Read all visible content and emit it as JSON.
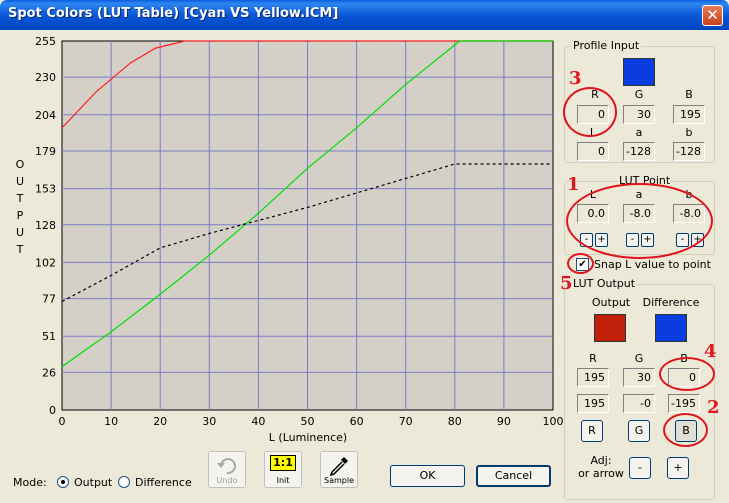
{
  "window": {
    "title": "Spot Colors (LUT Table) [Cyan VS Yellow.ICM]",
    "close_glyph": "✕"
  },
  "chart_data": {
    "type": "line",
    "ylabel": "OUTPUT",
    "xlabel": "L (Luminence)",
    "xlim": [
      0,
      100
    ],
    "ylim": [
      0,
      255
    ],
    "x_ticks": [
      "0",
      "10",
      "20",
      "30",
      "40",
      "50",
      "60",
      "70",
      "80",
      "90",
      "100"
    ],
    "y_ticks": [
      "0",
      "26",
      "51",
      "77",
      "102",
      "128",
      "153",
      "179",
      "204",
      "230",
      "255"
    ],
    "grid": true,
    "series": [
      {
        "color": "#FF2020",
        "style": "solid",
        "x": [
          0,
          7,
          14,
          19,
          25,
          30,
          100
        ],
        "y": [
          195,
          220,
          240,
          250,
          255,
          255,
          255
        ]
      },
      {
        "color": "#00DD00",
        "style": "solid",
        "x": [
          0,
          10,
          20,
          30,
          40,
          50,
          60,
          70,
          81,
          100
        ],
        "y": [
          30,
          54,
          80,
          107,
          136,
          167,
          195,
          225,
          255,
          255
        ]
      },
      {
        "color": "#000000",
        "style": "dashed",
        "x": [
          0,
          10,
          20,
          30,
          40,
          50,
          60,
          70,
          80,
          82,
          90,
          100
        ],
        "y": [
          75,
          93,
          112,
          122,
          131,
          140,
          150,
          160,
          170,
          170,
          170,
          170
        ]
      }
    ]
  },
  "profile_input": {
    "title": "Profile Input",
    "swatch_color": "#0A3CE0",
    "rgb_labels": [
      "R",
      "G",
      "B"
    ],
    "rgb_values": [
      "0",
      "30",
      "195"
    ],
    "lab_labels": [
      "L",
      "a",
      "b"
    ],
    "lab_values": [
      "0",
      "-128",
      "-128"
    ]
  },
  "lut_point": {
    "title": "LUT Point",
    "labels": [
      "L",
      "a",
      "b"
    ],
    "values": [
      "0.0",
      "-8.0",
      "-8.0"
    ],
    "minus": "-",
    "plus": "+"
  },
  "snap": {
    "label": "Snap L value to point",
    "checked": "✔"
  },
  "lut_output": {
    "title": "LUT Output",
    "output_label": "Output",
    "difference_label": "Difference",
    "output_color": "#C0200A",
    "difference_color": "#0A3CE0",
    "rgb_labels": [
      "R",
      "G",
      "B"
    ],
    "output_values": [
      "195",
      "30",
      "0"
    ],
    "difference_values": [
      "195",
      "-0",
      "-195"
    ],
    "channel_buttons": [
      "R",
      "G",
      "B"
    ],
    "adj_label_1": "Adj:",
    "adj_label_2": "or arrow",
    "adj_minus": "-",
    "adj_plus": "+"
  },
  "toolbar": {
    "undo_label": "Undo",
    "init_label": "Init",
    "init_glyph": "1:1",
    "sample_label": "Sample",
    "ok_label": "OK",
    "cancel_label": "Cancel"
  },
  "mode": {
    "label": "Mode:",
    "options": [
      "Output",
      "Difference"
    ],
    "selected": "Output"
  },
  "annotations": [
    "1",
    "2",
    "3",
    "4",
    "5"
  ]
}
